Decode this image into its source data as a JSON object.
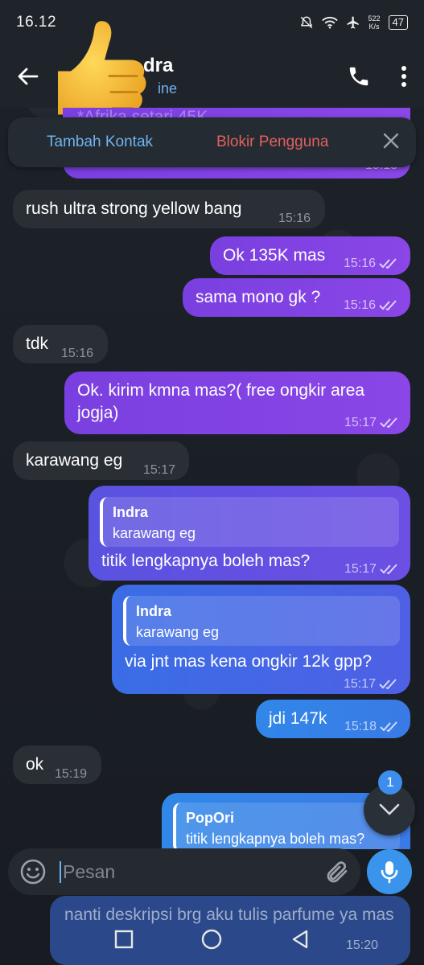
{
  "status_bar": {
    "time": "16.12",
    "net_speed_value": "522",
    "net_speed_unit": "K/s",
    "battery": "47"
  },
  "header": {
    "name_fragment": "dra",
    "status_fragment": "ine",
    "avatar_icon": "thumbs-up-emoji"
  },
  "action_bar": {
    "add_contact": "Tambah Kontak",
    "block_user": "Blokir Pengguna"
  },
  "messages": [
    {
      "id": "m0",
      "dir": "out",
      "text": "*Afrika setari 45K",
      "time": "15:13",
      "partial": true
    },
    {
      "id": "m1",
      "dir": "in",
      "text": "rush ultra strong yellow bang",
      "time": "15:16"
    },
    {
      "id": "m2",
      "dir": "out",
      "text": "Ok 135K mas",
      "time": "15:16"
    },
    {
      "id": "m3",
      "dir": "out",
      "text": "sama mono gk ?",
      "time": "15:16"
    },
    {
      "id": "m4",
      "dir": "in",
      "text": "tdk",
      "time": "15:16"
    },
    {
      "id": "m5",
      "dir": "out",
      "text": "Ok. kirim kmna mas?( free ongkir area jogja)",
      "time": "15:17"
    },
    {
      "id": "m6",
      "dir": "in",
      "text": "karawang eg",
      "time": "15:17"
    },
    {
      "id": "m7",
      "dir": "out",
      "reply_name": "Indra",
      "reply_text": "karawang eg",
      "text": "titik lengkapnya boleh mas?",
      "time": "15:17"
    },
    {
      "id": "m8",
      "dir": "out",
      "reply_name": "Indra",
      "reply_text": "karawang eg",
      "text": "via jnt mas kena ongkir 12k gpp?",
      "time": "15:17"
    },
    {
      "id": "m9",
      "dir": "out",
      "text": "jdi 147k",
      "time": "15:18"
    },
    {
      "id": "m10",
      "dir": "in",
      "text": "ok",
      "time": "15:19"
    },
    {
      "id": "m11",
      "dir": "out",
      "reply_name": "PopOri",
      "reply_text": "titik lengkapnya boleh mas?",
      "text": "",
      "time": ""
    },
    {
      "id": "m12",
      "dir": "out",
      "text": "nanti deskripsi brg aku tulis parfume ya mas",
      "time": "15:20"
    }
  ],
  "unread_count": "1",
  "composer": {
    "placeholder": "Pesan"
  }
}
